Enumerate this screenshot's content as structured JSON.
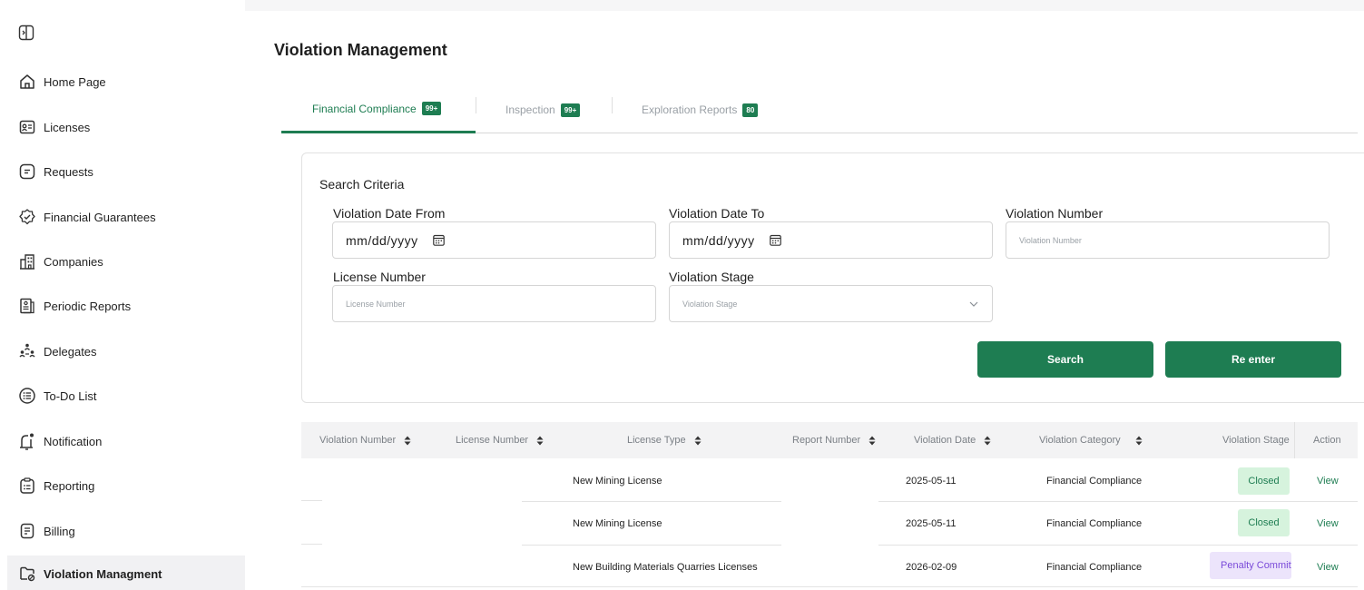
{
  "sidebar": {
    "items": [
      {
        "label": "Home Page",
        "icon": "home-icon"
      },
      {
        "label": "Licenses",
        "icon": "id-card-icon"
      },
      {
        "label": "Requests",
        "icon": "request-icon"
      },
      {
        "label": "Financial Guarantees",
        "icon": "badge-check-icon"
      },
      {
        "label": "Companies",
        "icon": "building-icon"
      },
      {
        "label": "Periodic Reports",
        "icon": "report-icon"
      },
      {
        "label": "Delegates",
        "icon": "people-icon"
      },
      {
        "label": "To-Do List",
        "icon": "list-icon"
      },
      {
        "label": "Notification",
        "icon": "bell-icon"
      },
      {
        "label": "Reporting",
        "icon": "clipboard-icon"
      },
      {
        "label": "Billing",
        "icon": "receipt-icon"
      },
      {
        "label": "Violation Managment",
        "icon": "violation-icon",
        "active": true
      }
    ]
  },
  "main": {
    "title": "Violation Management",
    "tabs": [
      {
        "label": "Financial Compliance",
        "badge": "99+",
        "active": true
      },
      {
        "label": "Inspection",
        "badge": "99+"
      },
      {
        "label": "Exploration Reports",
        "badge": "80"
      }
    ]
  },
  "search": {
    "title": "Search Criteria",
    "date_from_label": "Violation Date From",
    "date_from_value": "mm/dd/yyyy",
    "date_to_label": "Violation Date To",
    "date_to_value": "mm/dd/yyyy",
    "violation_number_label": "Violation Number",
    "violation_number_placeholder": "Violation Number",
    "license_number_label": "License Number",
    "license_number_placeholder": "License Number",
    "stage_label": "Violation Stage",
    "stage_placeholder": "Violation Stage",
    "search_button": "Search",
    "reenter_button": "Re enter"
  },
  "table": {
    "headers": [
      "Violation Number",
      "License Number",
      "License Type",
      "Report Number",
      "Violation Date",
      "Violation Category",
      "Violation Stage",
      "Action"
    ],
    "rows": [
      {
        "license_type": "New Mining License",
        "date": "2025-05-11",
        "category": "Financial Compliance",
        "stage": "Closed",
        "action": "View"
      },
      {
        "license_type": "New Mining License",
        "date": "2025-05-11",
        "category": "Financial Compliance",
        "stage": "Closed",
        "action": "View"
      },
      {
        "license_type": "New Building Materials Quarries Licenses",
        "date": "2026-02-09",
        "category": "Financial Compliance",
        "stage": "Penalty Committee",
        "action": "View"
      }
    ]
  },
  "colors": {
    "accent": "#1e7d52",
    "closed_bg": "#d6f3dd",
    "penalty_bg": "#ece4fb",
    "penalty_text": "#7a4ad9"
  }
}
